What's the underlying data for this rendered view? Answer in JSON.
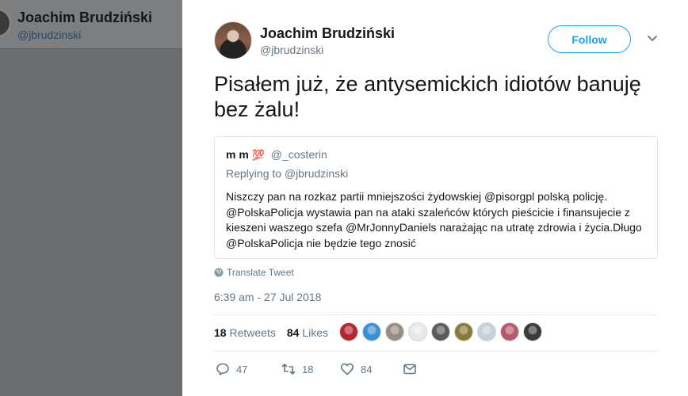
{
  "background_profile": {
    "name": "Joachim Brudziński",
    "handle": "@jbrudzinski"
  },
  "tweet": {
    "author_name": "Joachim Brudziński",
    "author_handle": "@jbrudzinski",
    "follow_label": "Follow",
    "text": "Pisałem już, że antysemickich idiotów banuję bez żalu!",
    "translate_label": "Translate Tweet",
    "timestamp": "6:39 am - 27 Jul 2018",
    "retweets_count": "18",
    "retweets_label": "Retweets",
    "likes_count": "84",
    "likes_label": "Likes",
    "actions": {
      "reply_count": "47",
      "retweet_count": "18",
      "like_count": "84"
    }
  },
  "quoted_tweet": {
    "name": "m m",
    "emoji": "💯",
    "handle": "@_costerin",
    "replying_prefix": "Replying to",
    "replying_handle": "@jbrudzinski",
    "text": "Niszczy pan na rozkaz partii mniejszości żydowskiej @pisorgpl polską policję. @PolskaPolicja wystawia pan na ataki szaleńców których pieścicie i finansujecie z kieszeni waszego szefa @MrJonnyDaniels narażając na utratę zdrowia i życia.Długo @PolskaPolicja nie będzie tego znosić"
  },
  "likers": [
    {
      "color": "#b3262d"
    },
    {
      "color": "#3a8fd6"
    },
    {
      "color": "#9a8c80"
    },
    {
      "color": "#e9e9e9"
    },
    {
      "color": "#5a5a5a"
    },
    {
      "color": "#8a7a3a"
    },
    {
      "color": "#c8d0d8"
    },
    {
      "color": "#b55a6a"
    },
    {
      "color": "#3a3a3a"
    }
  ],
  "colors": {
    "accent": "#1da1f2",
    "muted": "#657786",
    "text": "#14171a"
  }
}
